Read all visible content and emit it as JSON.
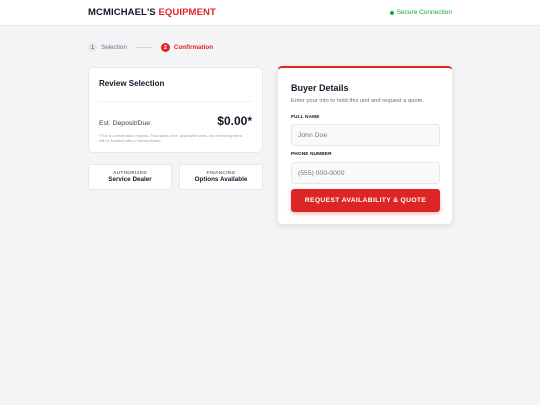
{
  "header": {
    "brand_primary": "MCMICHAEL'S",
    "brand_accent": "EQUIPMENT",
    "secure_label": "Secure Connection"
  },
  "steps": [
    {
      "num": "1",
      "label": "Selection",
      "state": "inactive"
    },
    {
      "num": "2",
      "label": "Confirmation",
      "state": "active"
    }
  ],
  "review": {
    "title": "Review Selection",
    "deposit_label": "Est. Deposit/Due:",
    "deposit_value": "$0.00*",
    "fine_print": "*This is a reservation request. Final sales price, applicable taxes, and financing terms will be finalized with a representative."
  },
  "badges": [
    {
      "top": "AUTHORIZED",
      "main": "Service Dealer"
    },
    {
      "top": "FINANCING",
      "main": "Options Available"
    }
  ],
  "buyer": {
    "title": "Buyer Details",
    "subtitle": "Enter your info to hold this unit and request a quote.",
    "name_label": "FULL NAME",
    "name_placeholder": "John Doe",
    "phone_label": "PHONE NUMBER",
    "phone_placeholder": "(555) 000-0000",
    "submit_label": "REQUEST AVAILABILITY & QUOTE"
  },
  "colors": {
    "accent": "#dc2626",
    "secure": "#16a34a",
    "background": "#f3f4f6"
  }
}
